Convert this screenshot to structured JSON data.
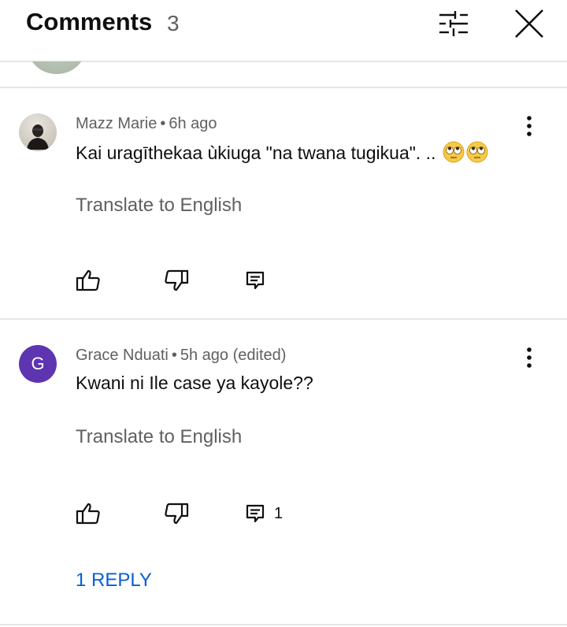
{
  "header": {
    "title": "Comments",
    "count": "3"
  },
  "comments": [
    {
      "author": "Mazz Marie",
      "separator": "•",
      "time": "6h ago",
      "edited": "",
      "text": "Kai uragīthekaa ùkiuga \"na twana tugikua\".  ..",
      "emoji": "🙄🙄",
      "translate": "Translate to English",
      "reply_count": ""
    },
    {
      "author": "Grace Nduati",
      "separator": "•",
      "time": "5h ago",
      "edited": "(edited)",
      "avatar_letter": "G",
      "text": "Kwani ni Ile case ya kayole??",
      "translate": "Translate to English",
      "reply_count": "1",
      "replies_link": "1 REPLY"
    }
  ],
  "colors": {
    "link": "#065fd4",
    "secondary_text": "#606060",
    "avatar_g": "#5e35b1"
  }
}
